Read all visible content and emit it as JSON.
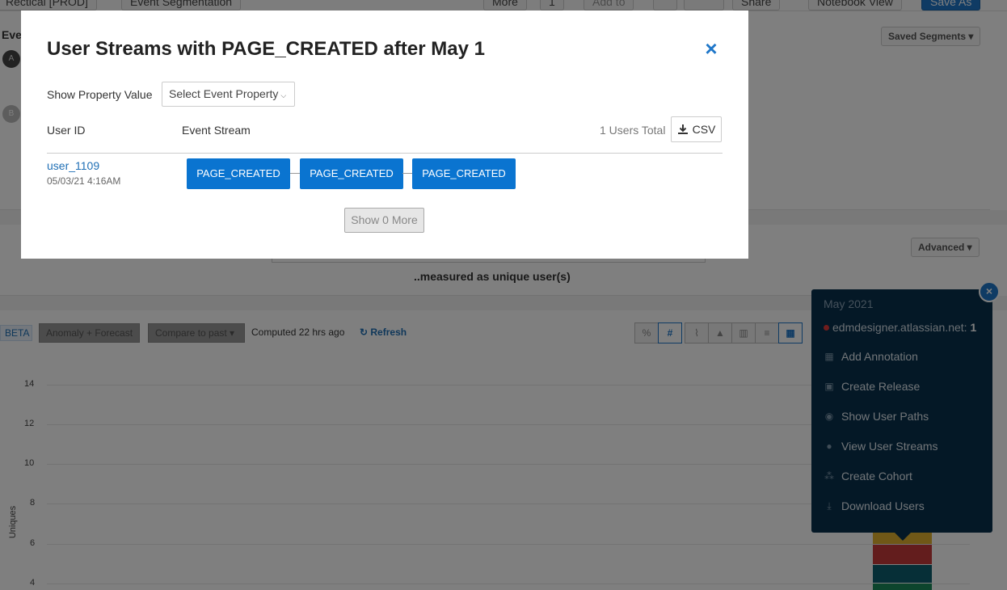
{
  "topbar": {
    "project": "Recticai [PROD]",
    "chart_type": "Event Segmentation",
    "more": "More",
    "counter": "1",
    "add_to": "Add to",
    "share": "Share",
    "notebook_view": "Notebook View",
    "save_as": "Save As"
  },
  "events_panel": {
    "heading": "Eve",
    "event_a_letter": "A",
    "event_b_letter": "B",
    "saved_segments": "Saved Segments ▾"
  },
  "measure_panel": {
    "advanced": "Advanced ▾",
    "measured_as": "..measured as unique user(s)"
  },
  "chart_toolbar": {
    "beta": "BETA",
    "anomaly": "Anomaly + Forecast",
    "compare": "Compare to past ▾",
    "computed": "Computed 22 hrs ago",
    "refresh": "Refresh",
    "percent": "%",
    "number": "#"
  },
  "chart_data": {
    "type": "bar",
    "ylabel": "Uniques",
    "y_ticks": [
      "14",
      "12",
      "10",
      "8",
      "6",
      "4"
    ],
    "ylim": [
      4,
      14
    ],
    "series_colors": [
      "#e0b12e",
      "#c73a3a",
      "#0d5e6e",
      "#1a8a5a"
    ]
  },
  "context_menu": {
    "month": "May 2021",
    "series_name": "edmdesigner.atlassian.net:",
    "series_value": "1",
    "items": [
      {
        "label": "Add Annotation",
        "icon": "calendar-icon"
      },
      {
        "label": "Create Release",
        "icon": "release-icon"
      },
      {
        "label": "Show User Paths",
        "icon": "eye-icon"
      },
      {
        "label": "View User Streams",
        "icon": "user-icon"
      },
      {
        "label": "Create Cohort",
        "icon": "cohort-icon"
      },
      {
        "label": "Download Users",
        "icon": "download-icon"
      }
    ]
  },
  "modal": {
    "title": "User Streams with PAGE_CREATED after May 1",
    "show_property_label": "Show Property Value",
    "select_property": "Select Event Property",
    "col_user_id": "User ID",
    "col_event_stream": "Event Stream",
    "users_total": "1 Users Total",
    "csv": "CSV",
    "show_more": "Show 0 More",
    "rows": [
      {
        "user_id": "user_1109",
        "date": "05/03/21 4:16AM",
        "events": [
          "PAGE_CREATED",
          "PAGE_CREATED",
          "PAGE_CREATED"
        ]
      }
    ]
  },
  "colors": {
    "accent": "#1f77c9",
    "event_pill": "#0a74d0",
    "menu_bg": "#08304d"
  }
}
